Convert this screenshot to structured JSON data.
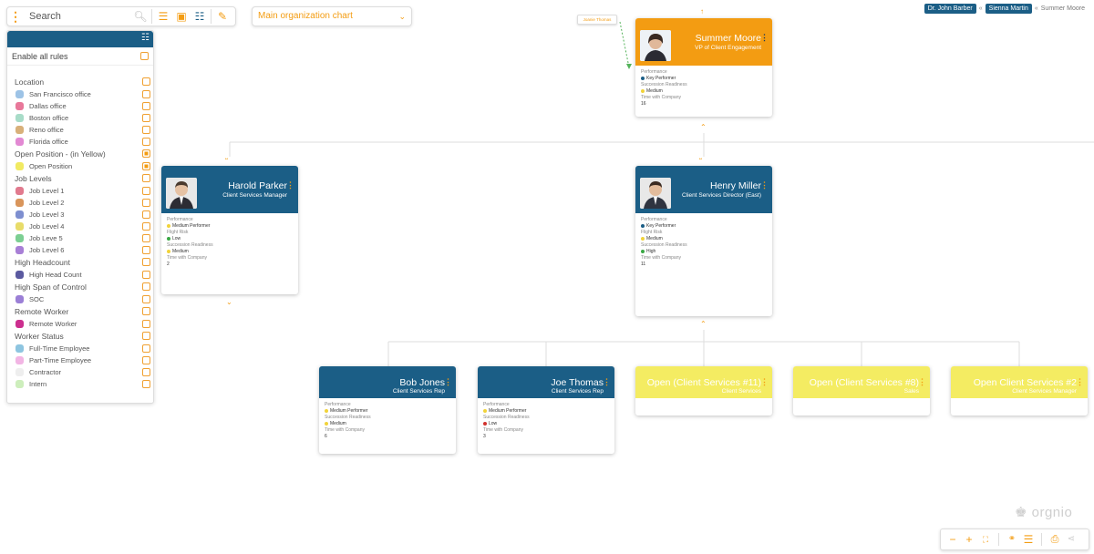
{
  "toolbar": {
    "search_placeholder": "Search",
    "chart_selector": "Main organization chart"
  },
  "breadcrumb": [
    "Dr. John Barber",
    "Sienna Martin",
    "Summer Moore"
  ],
  "breadcrumb_sep": "«",
  "rules": {
    "enable_all": "Enable all rules",
    "groups": [
      {
        "label": "Location",
        "checked": false,
        "items": [
          {
            "label": "San Francisco office",
            "color": "#9dc3e6",
            "checked": false
          },
          {
            "label": "Dallas office",
            "color": "#e8789a",
            "checked": false
          },
          {
            "label": "Boston office",
            "color": "#a8dcc8",
            "checked": false
          },
          {
            "label": "Reno office",
            "color": "#d8b07a",
            "checked": false
          },
          {
            "label": "Florida office",
            "color": "#e289d3",
            "checked": false
          }
        ]
      },
      {
        "label": "Open Position - (in Yellow)",
        "checked": true,
        "items": [
          {
            "label": "Open Position",
            "color": "#f1ea62",
            "checked": true
          }
        ]
      },
      {
        "label": "Job Levels",
        "checked": false,
        "items": [
          {
            "label": "Job Level 1",
            "color": "#e17a8e",
            "checked": false
          },
          {
            "label": "Job Level 2",
            "color": "#d9955b",
            "checked": false
          },
          {
            "label": "Job Level 3",
            "color": "#7e8fd0",
            "checked": false
          },
          {
            "label": "Job Level 4",
            "color": "#e8dc6a",
            "checked": false
          },
          {
            "label": "Job Leve 5",
            "color": "#7ccf93",
            "checked": false
          },
          {
            "label": "Job Level 6",
            "color": "#a87fd6",
            "checked": false
          }
        ]
      },
      {
        "label": "High Headcount",
        "checked": false,
        "items": [
          {
            "label": "High Head Count",
            "color": "#5b5aa0",
            "checked": false
          }
        ]
      },
      {
        "label": "High Span of Control",
        "checked": false,
        "items": [
          {
            "label": "SOC",
            "color": "#9b7fd6",
            "checked": false
          }
        ]
      },
      {
        "label": "Remote Worker",
        "checked": false,
        "items": [
          {
            "label": "Remote Worker",
            "color": "#cc2f8f",
            "checked": false
          }
        ]
      },
      {
        "label": "Worker Status",
        "checked": false,
        "items": [
          {
            "label": "Full-Time Employee",
            "color": "#8ec5e0",
            "checked": false
          },
          {
            "label": "Part-Time Employee",
            "color": "#f2b5e4",
            "checked": false
          },
          {
            "label": "Contractor",
            "color": "#eeeeee",
            "checked": false
          },
          {
            "label": "Intern",
            "color": "#cdeebc",
            "checked": false
          }
        ]
      }
    ]
  },
  "tag_label": "Joanie Thomas",
  "cards": {
    "summer": {
      "name": "Summer Moore",
      "title": "VP of Client Engagement",
      "fields": [
        {
          "label": "Performance",
          "value": "Key Performer",
          "dot": "#1b5e86"
        },
        {
          "label": "Succession Readiness",
          "value": "Medium",
          "dot": "#f1d33a"
        },
        {
          "label": "Time with Company",
          "value": "16",
          "dot": null
        }
      ]
    },
    "harold": {
      "name": "Harold Parker",
      "title": "Client Services Manager",
      "fields": [
        {
          "label": "Performance",
          "value": "Medium Performer",
          "dot": "#f1d33a"
        },
        {
          "label": "Flight Risk",
          "value": "Low",
          "dot": "#3aa845"
        },
        {
          "label": "Succession Readiness",
          "value": "Medium",
          "dot": "#f1d33a"
        },
        {
          "label": "Time with Company",
          "value": "2",
          "dot": null
        }
      ]
    },
    "henry": {
      "name": "Henry Miller",
      "title": "Client Services Director (East)",
      "fields": [
        {
          "label": "Performance",
          "value": "Key Performer",
          "dot": "#1b5e86"
        },
        {
          "label": "Flight Risk",
          "value": "Medium",
          "dot": "#f1d33a"
        },
        {
          "label": "Succession Readiness",
          "value": "High",
          "dot": "#3aa845"
        },
        {
          "label": "Time with Company",
          "value": "11",
          "dot": null
        }
      ]
    },
    "bob": {
      "name": "Bob Jones",
      "title": "Client Services Rep",
      "fields": [
        {
          "label": "Performance",
          "value": "Medium Performer",
          "dot": "#f1d33a"
        },
        {
          "label": "Succession Readiness",
          "value": "Medium",
          "dot": "#f1d33a"
        },
        {
          "label": "Time with Company",
          "value": "6",
          "dot": null
        }
      ]
    },
    "joe": {
      "name": "Joe Thomas",
      "title": "Client Services Rep",
      "fields": [
        {
          "label": "Performance",
          "value": "Medium Performer",
          "dot": "#f1d33a"
        },
        {
          "label": "Succession Readiness",
          "value": "Low",
          "dot": "#d1322e"
        },
        {
          "label": "Time with Company",
          "value": "3",
          "dot": null
        }
      ]
    },
    "open1": {
      "name": "Open (Client Services #11)",
      "title": "Client Services"
    },
    "open2": {
      "name": "Open (Client Services #8)",
      "title": "Sales"
    },
    "open3": {
      "name": "Open Client Services #2",
      "title": "Client Services Manager"
    }
  },
  "logo": "orgnio",
  "colors": {
    "brand_blue": "#1b5e86",
    "accent_orange": "#f39c12",
    "open_yellow": "#f4ec62"
  }
}
